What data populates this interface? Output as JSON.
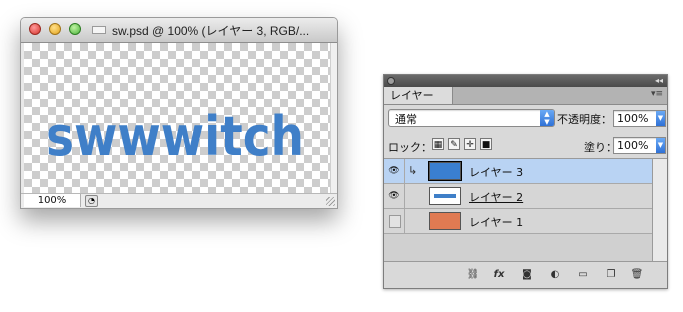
{
  "document": {
    "title": "sw.psd @ 100% (レイヤー 3, RGB/...",
    "zoom": "100%",
    "canvas_text": "swwwitch",
    "text_color": "#3f7fc8"
  },
  "layers_panel": {
    "tab_label": "レイヤー",
    "blend_mode": "通常",
    "opacity_label": "不透明度：",
    "opacity_value": "100%",
    "lock_label": "ロック：",
    "fill_label": "塗り：",
    "fill_value": "100%",
    "layers": [
      {
        "name": "レイヤー 3",
        "visible": true,
        "selected": true,
        "thumb_color": "#3a7fd0"
      },
      {
        "name": "レイヤー 2",
        "visible": true,
        "selected": false,
        "thumb": "text"
      },
      {
        "name": "レイヤー 1",
        "visible": false,
        "selected": false,
        "thumb_color": "#e07a52"
      }
    ],
    "bottom_icons": [
      "link-icon",
      "fx-icon",
      "mask-icon",
      "adjustment-icon",
      "group-icon",
      "new-layer-icon",
      "trash-icon"
    ]
  }
}
